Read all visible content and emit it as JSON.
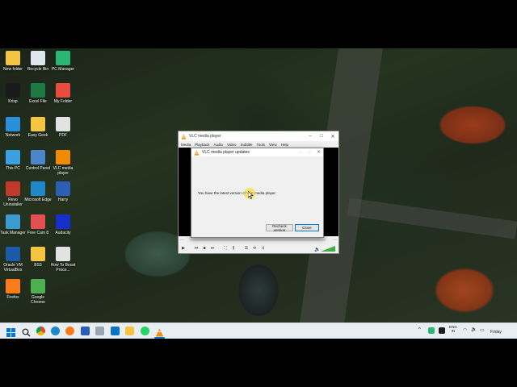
{
  "desktop_icons": [
    {
      "label": "New folder",
      "icon": "folder-icon",
      "color": "#f4c542"
    },
    {
      "label": "Recycle Bin",
      "icon": "recycle-bin-icon",
      "color": "#dfe7ee"
    },
    {
      "label": "PC Manager",
      "icon": "pc-manager-icon",
      "color": "#2bb673"
    },
    {
      "label": "Krisp",
      "icon": "krisp-icon",
      "color": "#1a1a1a"
    },
    {
      "label": "Excel File",
      "icon": "excel-icon",
      "color": "#1d7a45"
    },
    {
      "label": "My Folder",
      "icon": "house-folder-icon",
      "color": "#e94b3c"
    },
    {
      "label": "Network",
      "icon": "network-icon",
      "color": "#2a8fd8"
    },
    {
      "label": "Easy Geek",
      "icon": "folder-icon",
      "color": "#f4c542"
    },
    {
      "label": "PDF",
      "icon": "pdf-icon",
      "color": "#e2e2e2"
    },
    {
      "label": "This PC",
      "icon": "this-pc-icon",
      "color": "#3aa0e0"
    },
    {
      "label": "Control Panel",
      "icon": "control-panel-icon",
      "color": "#4a86c8"
    },
    {
      "label": "VLC media player",
      "icon": "vlc-icon",
      "color": "#f08a00"
    },
    {
      "label": "Revo Uninstaller",
      "icon": "revo-uninstaller-icon",
      "color": "#c0392b"
    },
    {
      "label": "Microsoft Edge",
      "icon": "edge-icon",
      "color": "#1e88c8"
    },
    {
      "label": "Harry",
      "icon": "word-icon",
      "color": "#2b5fb4"
    },
    {
      "label": "Task Manager",
      "icon": "task-manager-icon",
      "color": "#3d9ad1"
    },
    {
      "label": "Free Cam 8",
      "icon": "free-cam-icon",
      "color": "#e25050"
    },
    {
      "label": "Audacity",
      "icon": "audacity-icon",
      "color": "#1530c9"
    },
    {
      "label": "Oracle VM VirtualBox",
      "icon": "virtualbox-icon",
      "color": "#1b5aa6"
    },
    {
      "label": "BS3",
      "icon": "folder-icon",
      "color": "#f4c542"
    },
    {
      "label": "How To Boost Proce...",
      "icon": "pdf-icon",
      "color": "#e2e2e2"
    },
    {
      "label": "Firefox",
      "icon": "firefox-icon",
      "color": "#ff7a18"
    },
    {
      "label": "Google Chrome",
      "icon": "chrome-icon",
      "color": "#4caf50"
    }
  ],
  "vlc": {
    "title": "VLC media player",
    "menu": [
      "Media",
      "Playback",
      "Audio",
      "Video",
      "Subtitle",
      "Tools",
      "View",
      "Help"
    ],
    "time_left": "--:--",
    "time_right": "--:--",
    "volume_percent": 100
  },
  "dialog": {
    "title": "VLC media player updates",
    "message": "You have the latest version of VLC media player.",
    "recheck_label": "Recheck version",
    "close_label": "Close"
  },
  "taskbar": {
    "lang_line1": "ENG",
    "lang_line2": "IN",
    "day": "Friday"
  },
  "colors": {
    "accent": "#0078d7",
    "vlc_orange": "#f08a00"
  }
}
